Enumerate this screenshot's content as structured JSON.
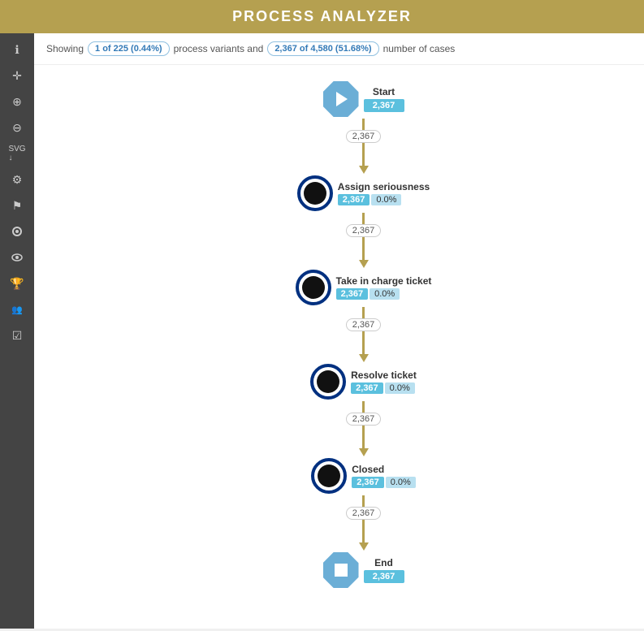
{
  "header": {
    "title": "PROCESS ANALYZER"
  },
  "topbar": {
    "showing_text": "Showing",
    "variants_badge": "1 of 225 (0.44%)",
    "middle_text": "process variants and",
    "cases_badge": "2,367 of 4,580 (51.68%)",
    "end_text": "number of cases"
  },
  "sidebar": {
    "buttons": [
      {
        "name": "info-icon",
        "symbol": "ℹ"
      },
      {
        "name": "cursor-icon",
        "symbol": "✛"
      },
      {
        "name": "zoom-in-icon",
        "symbol": "⊕"
      },
      {
        "name": "zoom-out-icon",
        "symbol": "⊖"
      },
      {
        "name": "download-svg-icon",
        "symbol": "↓"
      },
      {
        "name": "settings-icon",
        "symbol": "⚙"
      },
      {
        "name": "flag-icon",
        "symbol": "⚑"
      },
      {
        "name": "cycle-icon",
        "symbol": "♻"
      },
      {
        "name": "eye-filter-icon",
        "symbol": "👁"
      },
      {
        "name": "trophy-icon",
        "symbol": "🏆"
      },
      {
        "name": "people-icon",
        "symbol": "👥"
      },
      {
        "name": "checklist-icon",
        "symbol": "☑"
      }
    ]
  },
  "flow": {
    "start": {
      "name": "Start",
      "count": "2,367"
    },
    "connector1": {
      "count": "2,367"
    },
    "node1": {
      "name": "Assign seriousness",
      "count": "2,367",
      "percent": "0.0%"
    },
    "connector2": {
      "count": "2,367"
    },
    "node2": {
      "name": "Take in charge ticket",
      "count": "2,367",
      "percent": "0.0%"
    },
    "connector3": {
      "count": "2,367"
    },
    "node3": {
      "name": "Resolve ticket",
      "count": "2,367",
      "percent": "0.0%"
    },
    "connector4": {
      "count": "2,367"
    },
    "node4": {
      "name": "Closed",
      "count": "2,367",
      "percent": "0.0%"
    },
    "connector5": {
      "count": "2,367"
    },
    "end": {
      "name": "End",
      "count": "2,367"
    }
  }
}
